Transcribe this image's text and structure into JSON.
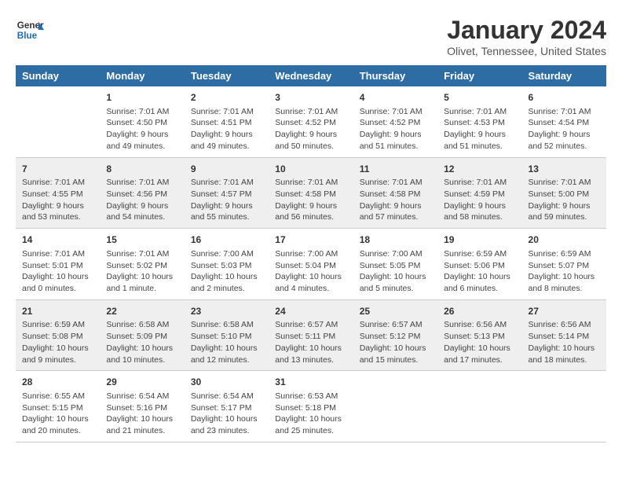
{
  "header": {
    "logo_line1": "General",
    "logo_line2": "Blue",
    "month": "January 2024",
    "location": "Olivet, Tennessee, United States"
  },
  "weekdays": [
    "Sunday",
    "Monday",
    "Tuesday",
    "Wednesday",
    "Thursday",
    "Friday",
    "Saturday"
  ],
  "weeks": [
    [
      {
        "day": "",
        "info": ""
      },
      {
        "day": "1",
        "info": "Sunrise: 7:01 AM\nSunset: 4:50 PM\nDaylight: 9 hours\nand 49 minutes."
      },
      {
        "day": "2",
        "info": "Sunrise: 7:01 AM\nSunset: 4:51 PM\nDaylight: 9 hours\nand 49 minutes."
      },
      {
        "day": "3",
        "info": "Sunrise: 7:01 AM\nSunset: 4:52 PM\nDaylight: 9 hours\nand 50 minutes."
      },
      {
        "day": "4",
        "info": "Sunrise: 7:01 AM\nSunset: 4:52 PM\nDaylight: 9 hours\nand 51 minutes."
      },
      {
        "day": "5",
        "info": "Sunrise: 7:01 AM\nSunset: 4:53 PM\nDaylight: 9 hours\nand 51 minutes."
      },
      {
        "day": "6",
        "info": "Sunrise: 7:01 AM\nSunset: 4:54 PM\nDaylight: 9 hours\nand 52 minutes."
      }
    ],
    [
      {
        "day": "7",
        "info": "Sunrise: 7:01 AM\nSunset: 4:55 PM\nDaylight: 9 hours\nand 53 minutes."
      },
      {
        "day": "8",
        "info": "Sunrise: 7:01 AM\nSunset: 4:56 PM\nDaylight: 9 hours\nand 54 minutes."
      },
      {
        "day": "9",
        "info": "Sunrise: 7:01 AM\nSunset: 4:57 PM\nDaylight: 9 hours\nand 55 minutes."
      },
      {
        "day": "10",
        "info": "Sunrise: 7:01 AM\nSunset: 4:58 PM\nDaylight: 9 hours\nand 56 minutes."
      },
      {
        "day": "11",
        "info": "Sunrise: 7:01 AM\nSunset: 4:58 PM\nDaylight: 9 hours\nand 57 minutes."
      },
      {
        "day": "12",
        "info": "Sunrise: 7:01 AM\nSunset: 4:59 PM\nDaylight: 9 hours\nand 58 minutes."
      },
      {
        "day": "13",
        "info": "Sunrise: 7:01 AM\nSunset: 5:00 PM\nDaylight: 9 hours\nand 59 minutes."
      }
    ],
    [
      {
        "day": "14",
        "info": "Sunrise: 7:01 AM\nSunset: 5:01 PM\nDaylight: 10 hours\nand 0 minutes."
      },
      {
        "day": "15",
        "info": "Sunrise: 7:01 AM\nSunset: 5:02 PM\nDaylight: 10 hours\nand 1 minute."
      },
      {
        "day": "16",
        "info": "Sunrise: 7:00 AM\nSunset: 5:03 PM\nDaylight: 10 hours\nand 2 minutes."
      },
      {
        "day": "17",
        "info": "Sunrise: 7:00 AM\nSunset: 5:04 PM\nDaylight: 10 hours\nand 4 minutes."
      },
      {
        "day": "18",
        "info": "Sunrise: 7:00 AM\nSunset: 5:05 PM\nDaylight: 10 hours\nand 5 minutes."
      },
      {
        "day": "19",
        "info": "Sunrise: 6:59 AM\nSunset: 5:06 PM\nDaylight: 10 hours\nand 6 minutes."
      },
      {
        "day": "20",
        "info": "Sunrise: 6:59 AM\nSunset: 5:07 PM\nDaylight: 10 hours\nand 8 minutes."
      }
    ],
    [
      {
        "day": "21",
        "info": "Sunrise: 6:59 AM\nSunset: 5:08 PM\nDaylight: 10 hours\nand 9 minutes."
      },
      {
        "day": "22",
        "info": "Sunrise: 6:58 AM\nSunset: 5:09 PM\nDaylight: 10 hours\nand 10 minutes."
      },
      {
        "day": "23",
        "info": "Sunrise: 6:58 AM\nSunset: 5:10 PM\nDaylight: 10 hours\nand 12 minutes."
      },
      {
        "day": "24",
        "info": "Sunrise: 6:57 AM\nSunset: 5:11 PM\nDaylight: 10 hours\nand 13 minutes."
      },
      {
        "day": "25",
        "info": "Sunrise: 6:57 AM\nSunset: 5:12 PM\nDaylight: 10 hours\nand 15 minutes."
      },
      {
        "day": "26",
        "info": "Sunrise: 6:56 AM\nSunset: 5:13 PM\nDaylight: 10 hours\nand 17 minutes."
      },
      {
        "day": "27",
        "info": "Sunrise: 6:56 AM\nSunset: 5:14 PM\nDaylight: 10 hours\nand 18 minutes."
      }
    ],
    [
      {
        "day": "28",
        "info": "Sunrise: 6:55 AM\nSunset: 5:15 PM\nDaylight: 10 hours\nand 20 minutes."
      },
      {
        "day": "29",
        "info": "Sunrise: 6:54 AM\nSunset: 5:16 PM\nDaylight: 10 hours\nand 21 minutes."
      },
      {
        "day": "30",
        "info": "Sunrise: 6:54 AM\nSunset: 5:17 PM\nDaylight: 10 hours\nand 23 minutes."
      },
      {
        "day": "31",
        "info": "Sunrise: 6:53 AM\nSunset: 5:18 PM\nDaylight: 10 hours\nand 25 minutes."
      },
      {
        "day": "",
        "info": ""
      },
      {
        "day": "",
        "info": ""
      },
      {
        "day": "",
        "info": ""
      }
    ]
  ]
}
